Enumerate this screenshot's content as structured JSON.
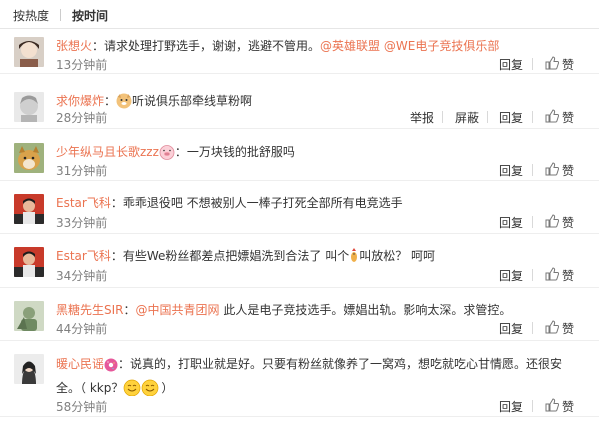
{
  "tabs": [
    {
      "label": "按热度"
    },
    {
      "label": "按时间"
    }
  ],
  "actions": {
    "reply": "回复",
    "like": "赞",
    "report": "举报",
    "block": "屏蔽"
  },
  "comments": [
    {
      "user": "张想火",
      "colon": "：",
      "pre": "请求处理打野选手，谢谢，逃避不管用。",
      "m1": "@英雄联盟",
      "m2": "@WE电子竞技俱乐部",
      "time": "13分钟前"
    },
    {
      "user": "求你爆炸",
      "colon": "：",
      "text": "听说俱乐部牵线草粉啊",
      "time": "28分钟前"
    },
    {
      "user": "少年纵马且长歌zzz",
      "colon": "：一万块钱的批舒服吗",
      "time": "31分钟前"
    },
    {
      "user": "Estar飞科",
      "colon": "：",
      "text": "乖乖退役吧 不想被别人一棒子打死全部所有电竞选手",
      "time": "33分钟前"
    },
    {
      "user": "Estar飞科",
      "colon": "：",
      "pre": "有些We粉丝都差点把嫖娼洗到合法了 叫个",
      "post": "叫放松？ 呵呵",
      "time": "34分钟前"
    },
    {
      "user": "黑糖先生SIR",
      "colon": "：",
      "m1": "@中国共青团网",
      "text": " 此人是电子竞技选手。嫖娼出轨。影响太深。求管控。",
      "time": "44分钟前"
    },
    {
      "user": "暖心民谣",
      "colon": "：",
      "line1": "说真的，打职业就是好。只要有粉丝就像养了一窝鸡，想吃就吃心甘情愿。还很安",
      "line2a": "全。（ kkp？",
      "line2b": "）",
      "time": "58分钟前"
    }
  ],
  "colors": {
    "link": "#eb7350",
    "time": "#808080",
    "text": "#333333"
  }
}
